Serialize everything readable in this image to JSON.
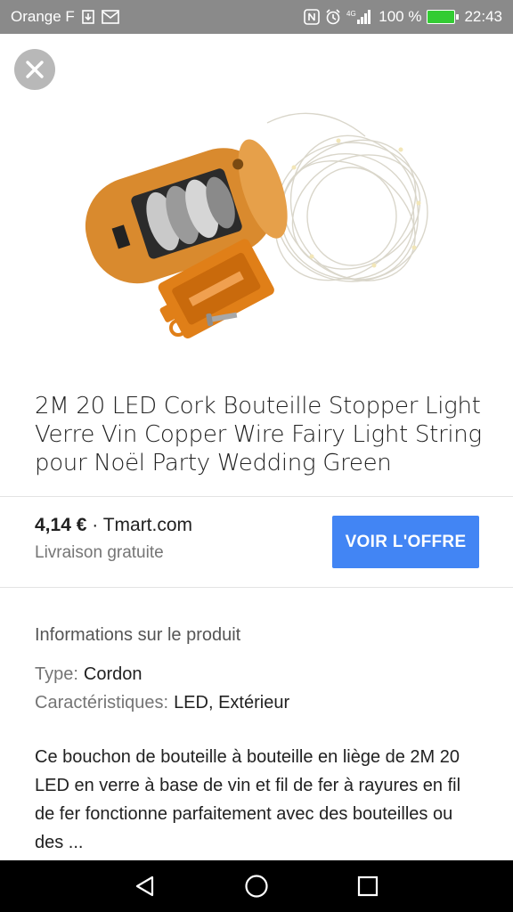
{
  "status_bar": {
    "carrier": "Orange F",
    "network": "4G",
    "battery": "100 %",
    "time": "22:43",
    "icons": [
      "sim-icon",
      "mail-icon",
      "nfc-icon",
      "alarm-icon",
      "signal-icon",
      "battery-charging-icon"
    ]
  },
  "colors": {
    "status_bar_bg": "#8a8a8a",
    "accent": "#4285f4",
    "battery": "#33cc33",
    "cork": "#d98a2e"
  },
  "product": {
    "title": "2M 20 LED Cork Bouteille Stopper Light Verre Vin Copper Wire Fairy Light String pour Noël Party Wedding Green",
    "image_icon": "cork-bottle-light-product-photo"
  },
  "offer": {
    "price": "4,14 €",
    "separator": " · ",
    "merchant": "Tmart.com",
    "shipping": "Livraison gratuite",
    "button_label": "VOIR L'OFFRE"
  },
  "info": {
    "heading": "Informations sur le produit",
    "specs": [
      {
        "label": "Type:",
        "value": "Cordon"
      },
      {
        "label": "Caractéristiques:",
        "value": "LED, Extérieur"
      }
    ],
    "description": "Ce bouchon de bouteille à bouteille en liège de 2M 20 LED en verre à base de vin et fil de fer à rayures en fil de fer fonctionne parfaitement avec des bouteilles ou des ..."
  },
  "nav": {
    "icons": [
      "back-icon",
      "home-icon",
      "recents-icon"
    ]
  }
}
